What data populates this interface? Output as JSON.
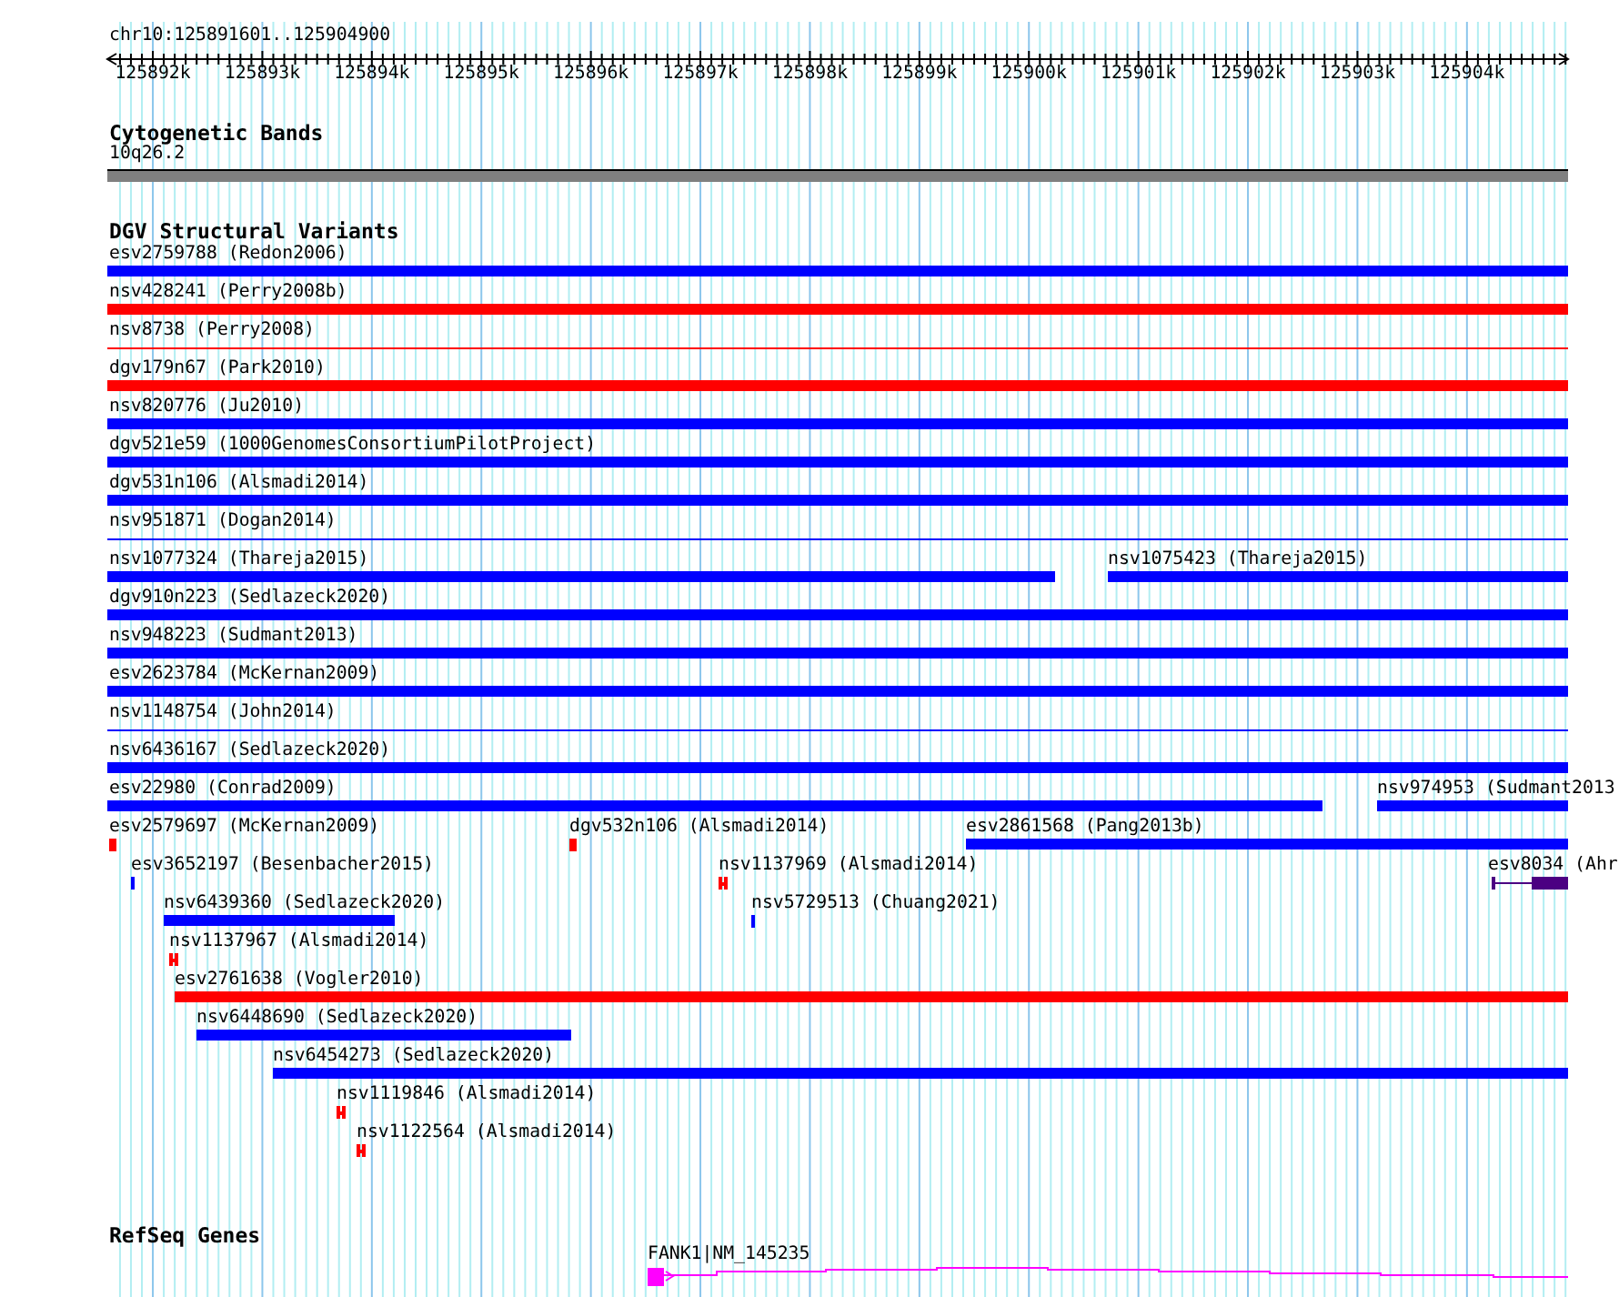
{
  "ruler": {
    "location": "chr10:125891601..125904900",
    "ticks": [
      "125892k",
      "125893k",
      "125894k",
      "125895k",
      "125896k",
      "125897k",
      "125898k",
      "125899k",
      "125900k",
      "125901k",
      "125902k",
      "125903k",
      "125904k"
    ]
  },
  "tracks": [
    {
      "title": "Cytogenetic Bands",
      "kind": "bands",
      "features": [
        {
          "label": "10q26.2"
        }
      ]
    },
    {
      "title": "DGV Structural Variants",
      "kind": "variants",
      "features": [
        {
          "label": "esv2759788 (Redon2006)",
          "kind": "bar",
          "color": "#0000ff"
        },
        {
          "label": "nsv428241 (Perry2008b)",
          "kind": "bar",
          "color": "#ff0000"
        },
        {
          "label": "nsv8738 (Perry2008)",
          "kind": "line",
          "color": "#ff0000"
        },
        {
          "label": "dgv179n67 (Park2010)",
          "kind": "bar",
          "color": "#ff0000"
        },
        {
          "label": "nsv820776 (Ju2010)",
          "kind": "bar",
          "color": "#0000ff"
        },
        {
          "label": "dgv521e59 (1000GenomesConsortiumPilotProject)",
          "kind": "bar",
          "color": "#0000ff"
        },
        {
          "label": "dgv531n106 (Alsmadi2014)",
          "kind": "bar",
          "color": "#0000ff"
        },
        {
          "label": "nsv951871 (Dogan2014)",
          "kind": "line",
          "color": "#0000ff"
        },
        {
          "label": "nsv1077324 (Thareja2015)",
          "kind": "bar",
          "color": "#0000ff"
        },
        {
          "label": "nsv1075423 (Thareja2015)",
          "kind": "bar",
          "color": "#0000ff"
        },
        {
          "label": "dgv910n223 (Sedlazeck2020)",
          "kind": "bar",
          "color": "#0000ff"
        },
        {
          "label": "nsv948223 (Sudmant2013)",
          "kind": "bar",
          "color": "#0000ff"
        },
        {
          "label": "esv2623784 (McKernan2009)",
          "kind": "bar",
          "color": "#0000ff"
        },
        {
          "label": "nsv1148754 (John2014)",
          "kind": "line",
          "color": "#0000ff"
        },
        {
          "label": "nsv6436167 (Sedlazeck2020)",
          "kind": "bar",
          "color": "#0000ff"
        },
        {
          "label": "esv22980 (Conrad2009)",
          "kind": "bar",
          "color": "#0000ff"
        },
        {
          "label": "nsv974953 (Sudmant2013",
          "kind": "bar",
          "color": "#0000ff"
        },
        {
          "label": "esv2579697 (McKernan2009)",
          "kind": "marker",
          "color": "#ff0000"
        },
        {
          "label": "dgv532n106 (Alsmadi2014)",
          "kind": "block",
          "color": "#ff0000"
        },
        {
          "label": "esv2861568 (Pang2013b)",
          "kind": "bar",
          "color": "#0000ff"
        },
        {
          "label": "esv3652197 (Besenbacher2015)",
          "kind": "block",
          "color": "#0000ff"
        },
        {
          "label": "nsv1137969 (Alsmadi2014)",
          "kind": "marker",
          "color": "#ff0000"
        },
        {
          "label": "esv8034 (Ahr",
          "kind": "exon",
          "color": "#4b0082"
        },
        {
          "label": "nsv6439360 (Sedlazeck2020)",
          "kind": "bar",
          "color": "#0000ff"
        },
        {
          "label": "nsv5729513 (Chuang2021)",
          "kind": "block",
          "color": "#0000ff"
        },
        {
          "label": "nsv1137967 (Alsmadi2014)",
          "kind": "marker",
          "color": "#ff0000"
        },
        {
          "label": "esv2761638 (Vogler2010)",
          "kind": "bar",
          "color": "#ff0000"
        },
        {
          "label": "nsv6448690 (Sedlazeck2020)",
          "kind": "bar",
          "color": "#0000ff"
        },
        {
          "label": "nsv6454273 (Sedlazeck2020)",
          "kind": "bar",
          "color": "#0000ff"
        },
        {
          "label": "nsv1119846 (Alsmadi2014)",
          "kind": "marker",
          "color": "#ff0000"
        },
        {
          "label": "nsv1122564 (Alsmadi2014)",
          "kind": "marker",
          "color": "#ff0000"
        }
      ]
    },
    {
      "title": "RefSeq Genes",
      "kind": "genes",
      "features": [
        {
          "label": "FANK1|NM_145235",
          "color": "#ff00ff"
        }
      ]
    }
  ]
}
